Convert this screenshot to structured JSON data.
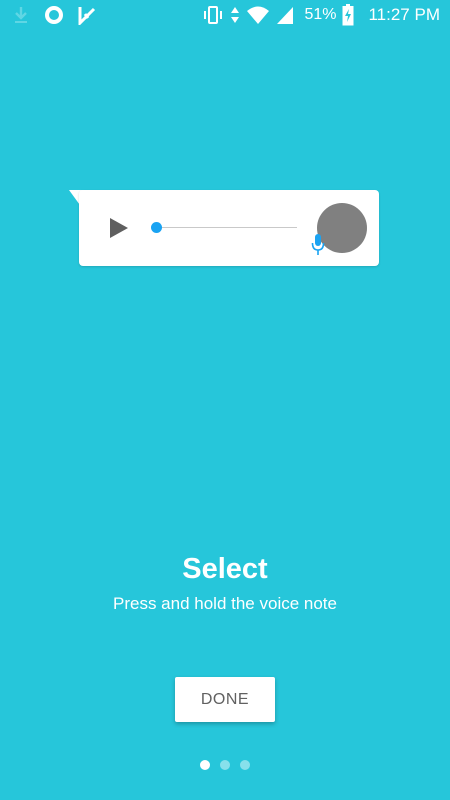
{
  "status_bar": {
    "left_icons": [
      "download-icon",
      "circle-app-icon",
      "checkmark-app-icon"
    ],
    "right_icons": [
      "vibrate-icon",
      "data-arrows-icon",
      "wifi-icon",
      "signal-icon",
      "battery-charging-icon"
    ],
    "battery": "51%",
    "time": "11:27 PM"
  },
  "voice_note": {
    "icons": [
      "play-icon",
      "microphone-icon"
    ],
    "progress": 0,
    "colors": {
      "card": "#FFFFFF",
      "accent": "#1AA3F2",
      "avatar": "#808080"
    }
  },
  "onboarding": {
    "title": "Select",
    "subtitle": "Press and hold the voice note",
    "done_label": "DONE",
    "pages": 3,
    "current_page": 1
  },
  "colors": {
    "background": "#26C6DA",
    "text": "#FFFFFF",
    "button_text": "#616161"
  }
}
